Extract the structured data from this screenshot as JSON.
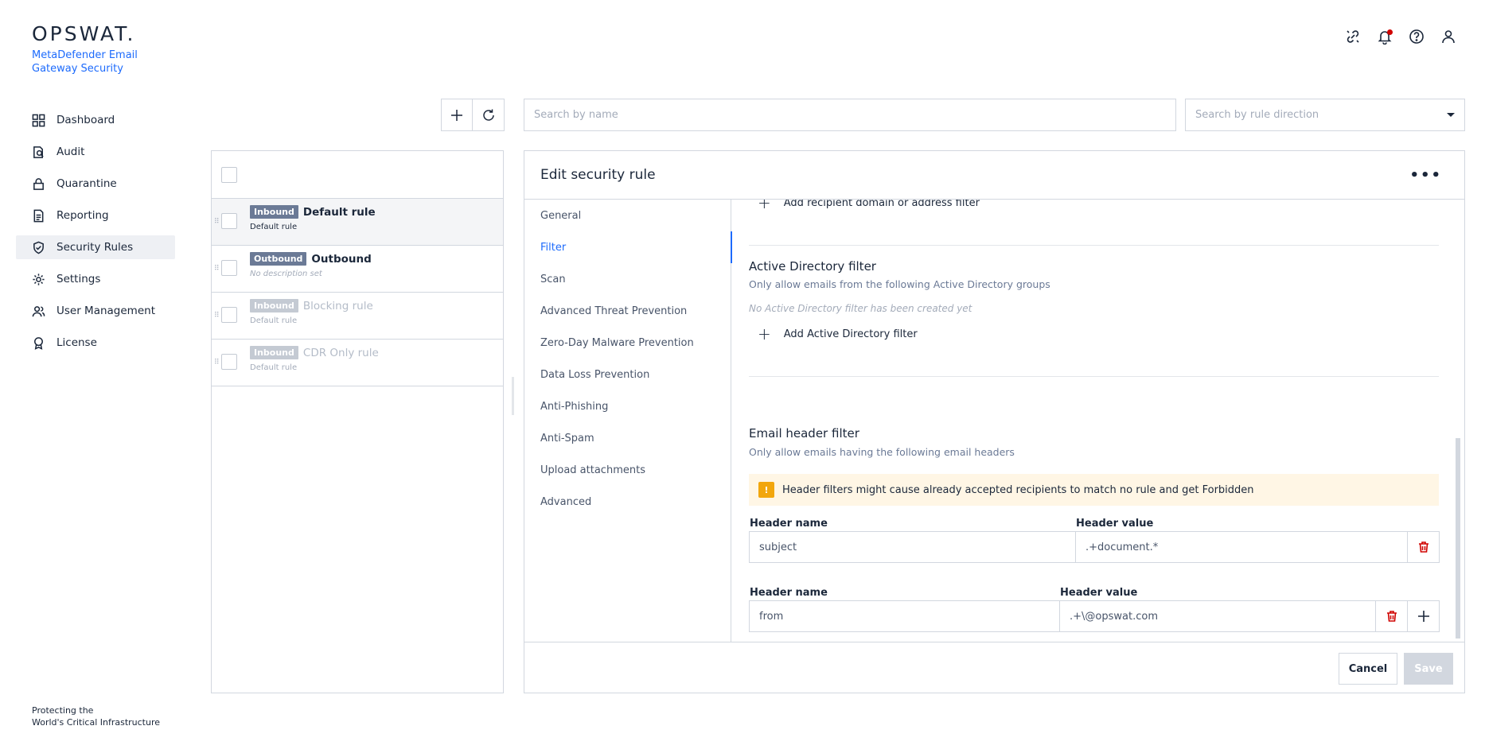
{
  "brand": {
    "logo": "OPSWAT.",
    "product_line1": "MetaDefender Email",
    "product_line2": "Gateway Security",
    "footer_line1": "Protecting the",
    "footer_line2": "World's Critical Infrastructure"
  },
  "nav": {
    "items": [
      {
        "label": "Dashboard",
        "icon": "grid-icon"
      },
      {
        "label": "Audit",
        "icon": "audit-icon"
      },
      {
        "label": "Quarantine",
        "icon": "lock-icon"
      },
      {
        "label": "Reporting",
        "icon": "document-icon"
      },
      {
        "label": "Security Rules",
        "icon": "shield-check-icon",
        "active": true
      },
      {
        "label": "Settings",
        "icon": "gear-icon"
      },
      {
        "label": "User Management",
        "icon": "users-icon"
      },
      {
        "label": "License",
        "icon": "badge-icon"
      }
    ]
  },
  "toolbar": {
    "search_name_placeholder": "Search by name",
    "search_direction_placeholder": "Search by rule direction"
  },
  "rules": [
    {
      "direction": "Inbound",
      "name": "Default rule",
      "desc": "Default rule",
      "selected": true,
      "dim": false
    },
    {
      "direction": "Outbound",
      "name": "Outbound",
      "desc": "No description set",
      "selected": false,
      "dim": false
    },
    {
      "direction": "Inbound",
      "name": "Blocking rule",
      "desc": "Default rule",
      "selected": false,
      "dim": true
    },
    {
      "direction": "Inbound",
      "name": "CDR Only rule",
      "desc": "Default rule",
      "selected": false,
      "dim": true
    }
  ],
  "edit": {
    "title": "Edit security rule",
    "more": "•••",
    "tabs": [
      "General",
      "Filter",
      "Scan",
      "Advanced Threat Prevention",
      "Zero-Day Malware Prevention",
      "Data Loss Prevention",
      "Anti-Phishing",
      "Anti-Spam",
      "Upload attachments",
      "Advanced"
    ],
    "active_tab": "Filter",
    "add_recipient": "Add recipient domain or address filter",
    "ad_filter": {
      "title": "Active Directory filter",
      "subtitle": "Only allow emails from the following Active Directory groups",
      "empty": "No Active Directory filter has been created yet",
      "add": "Add Active Directory filter"
    },
    "header_filter": {
      "title": "Email header filter",
      "subtitle": "Only allow emails having the following email headers",
      "warning": "Header filters might cause already accepted recipients to match no rule and get Forbidden",
      "name_label": "Header name",
      "value_label": "Header value",
      "rows": [
        {
          "name": "subject",
          "value": ".+document.*"
        },
        {
          "name": "from",
          "value": ".+\\@opswat.com"
        }
      ]
    },
    "cancel": "Cancel",
    "save": "Save"
  }
}
